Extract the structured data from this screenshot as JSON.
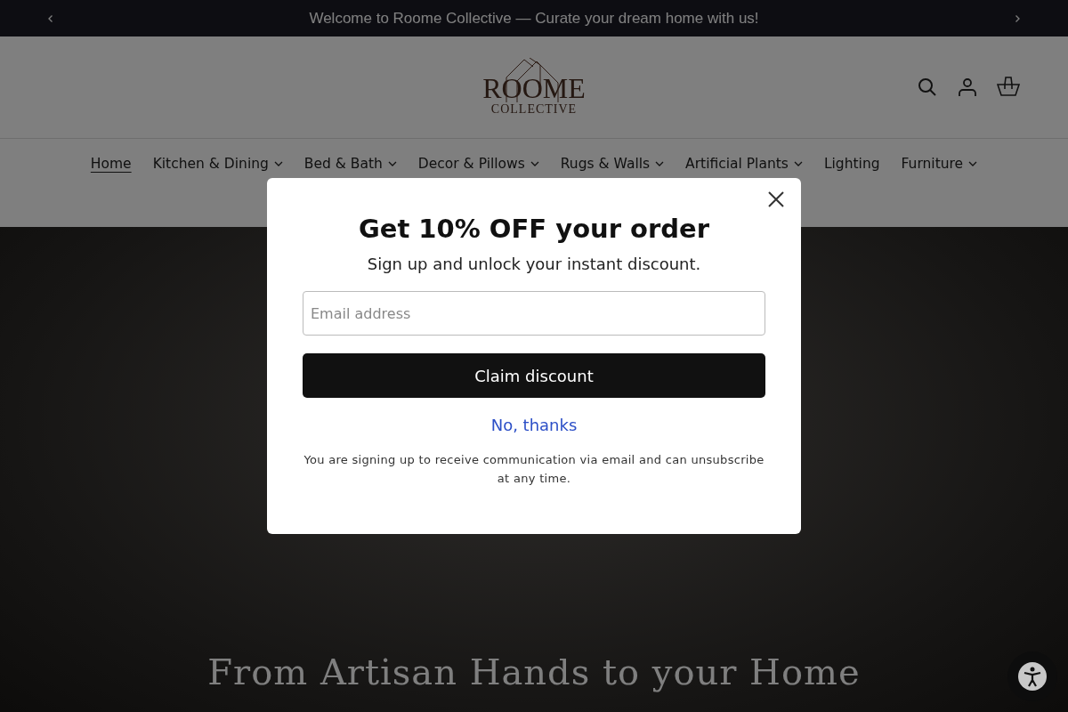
{
  "announcement": {
    "text": "Welcome to Roome Collective — Curate your dream home with us!"
  },
  "logo": {
    "name": "ROOME",
    "tagline": "COLLECTIVE"
  },
  "nav": [
    {
      "label": "Home",
      "selected": true,
      "has_menu": false
    },
    {
      "label": "Kitchen & Dining",
      "selected": false,
      "has_menu": true
    },
    {
      "label": "Bed & Bath",
      "selected": false,
      "has_menu": true
    },
    {
      "label": "Decor & Pillows",
      "selected": false,
      "has_menu": true
    },
    {
      "label": "Rugs & Walls",
      "selected": false,
      "has_menu": true
    },
    {
      "label": "Artificial Plants",
      "selected": false,
      "has_menu": true
    },
    {
      "label": "Lighting",
      "selected": false,
      "has_menu": false
    },
    {
      "label": "Furniture",
      "selected": false,
      "has_menu": true
    }
  ],
  "hero": {
    "title": "From Artisan Hands to your Home"
  },
  "modal": {
    "title": "Get 10% OFF your order",
    "subtitle": "Sign up and unlock your instant discount.",
    "email_placeholder": "Email address",
    "submit": "Claim discount",
    "decline": "No, thanks",
    "disclaimer": "You are signing up to receive communication via email and can unsubscribe at any time."
  }
}
